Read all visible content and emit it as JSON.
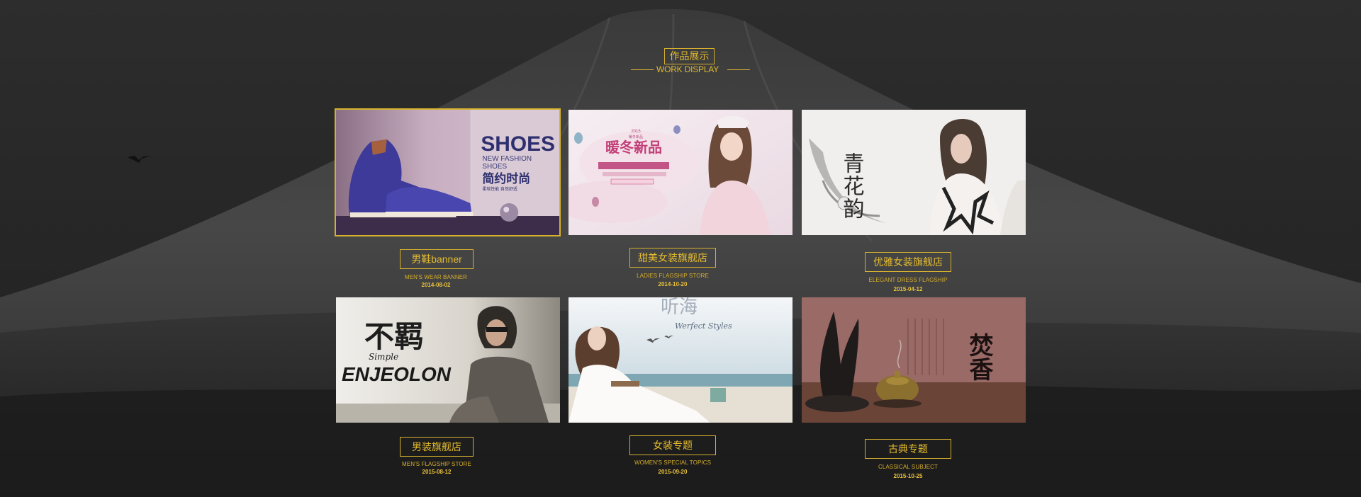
{
  "header": {
    "title": "作品展示",
    "subtitle": "WORK DISPLAY"
  },
  "colors": {
    "accent": "#d5b02f",
    "background": "#262626"
  },
  "works": [
    {
      "title": "男鞋banner",
      "subtitle": "MEN'S WEAR BANNER",
      "date": "2014-08-02",
      "image": {
        "headline": "SHOES",
        "line1": "NEW FASHION",
        "line2": "SHOES",
        "cn": "简约时尚",
        "cn_small": "柔软性能  自然舒适"
      }
    },
    {
      "title": "甜美女装旗舰店",
      "subtitle": "LADIES FLAGSHIP STORE",
      "date": "2014-10-20",
      "image": {
        "top": "2015",
        "top2": "暖冬新品",
        "headline": "暖冬新品"
      }
    },
    {
      "title": "优雅女装旗舰店",
      "subtitle": "ELEGANT DRESS FLAGSHIP",
      "date": "2015-04-12",
      "image": {
        "headline": "青花韵"
      }
    },
    {
      "title": "男装旗舰店",
      "subtitle": "MEN'S FLAGSHIP STORE",
      "date": "2015-08-12",
      "image": {
        "cn": "不羁",
        "script": "Simple",
        "headline": "ENJEOLON"
      }
    },
    {
      "title": "女装专题",
      "subtitle": "WOMEN'S SPECIAL TOPICS",
      "date": "2015-09-20",
      "image": {
        "cn": "听海",
        "script": "Werfect Styles"
      }
    },
    {
      "title": "古典专题",
      "subtitle": "CLASSICAL SUBJECT",
      "date": "2015-10-25",
      "image": {
        "headline": "焚香"
      }
    }
  ]
}
